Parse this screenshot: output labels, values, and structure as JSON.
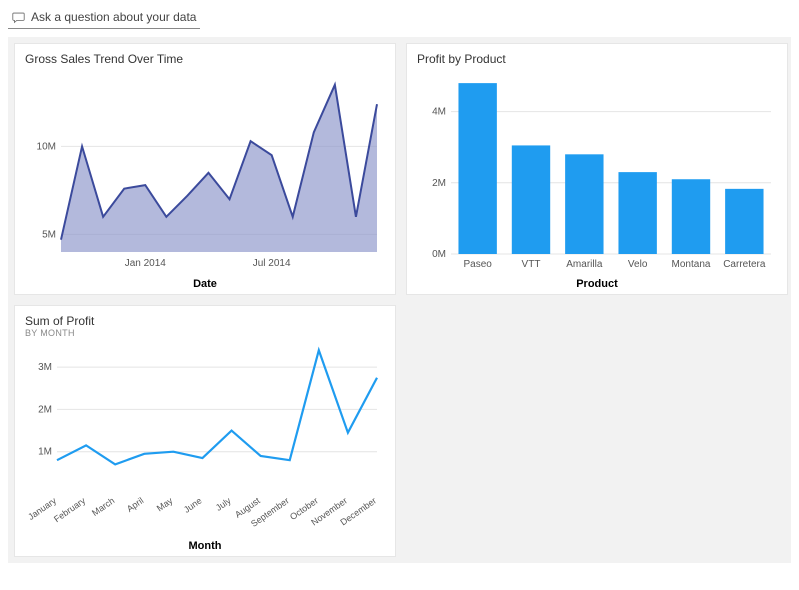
{
  "qna_placeholder": "Ask a question about your data",
  "cards": {
    "gross_sales": {
      "title": "Gross Sales Trend Over Time",
      "xlabel": "Date"
    },
    "profit_product": {
      "title": "Profit by Product",
      "xlabel": "Product"
    },
    "sum_profit": {
      "title": "Sum of Profit",
      "subtitle": "By Month",
      "xlabel": "Month"
    }
  },
  "chart_data": [
    {
      "id": "gross_sales",
      "type": "area",
      "title": "Gross Sales Trend Over Time",
      "xlabel": "Date",
      "ylabel": "",
      "ylim": [
        4000000,
        14000000
      ],
      "x_ticks_shown": [
        "Jan 2014",
        "Jul 2014"
      ],
      "y_ticks_shown": [
        "5M",
        "10M"
      ],
      "x": [
        "Sep 2013",
        "Oct 2013",
        "Nov 2013",
        "Dec 2013",
        "Jan 2014",
        "Feb 2014",
        "Mar 2014",
        "Apr 2014",
        "May 2014",
        "Jun 2014",
        "Jul 2014",
        "Aug 2014",
        "Sep 2014",
        "Oct 2014",
        "Nov 2014",
        "Dec 2014"
      ],
      "values": [
        4700000,
        10000000,
        6000000,
        7600000,
        7800000,
        6000000,
        7200000,
        8500000,
        7000000,
        10300000,
        9500000,
        6000000,
        10800000,
        13500000,
        6000000,
        12400000
      ]
    },
    {
      "id": "profit_product",
      "type": "bar",
      "title": "Profit by Product",
      "xlabel": "Product",
      "ylabel": "",
      "ylim": [
        0,
        5000000
      ],
      "y_ticks_shown": [
        "0M",
        "2M",
        "4M"
      ],
      "categories": [
        "Paseo",
        "VTT",
        "Amarilla",
        "Velo",
        "Montana",
        "Carretera"
      ],
      "values": [
        4800000,
        3050000,
        2800000,
        2300000,
        2100000,
        1830000
      ]
    },
    {
      "id": "sum_profit",
      "type": "line",
      "title": "Sum of Profit",
      "subtitle": "By Month",
      "xlabel": "Month",
      "ylabel": "",
      "ylim": [
        0,
        3500000
      ],
      "y_ticks_shown": [
        "1M",
        "2M",
        "3M"
      ],
      "categories": [
        "January",
        "February",
        "March",
        "April",
        "May",
        "June",
        "July",
        "August",
        "September",
        "October",
        "November",
        "December"
      ],
      "values": [
        800000,
        1150000,
        700000,
        950000,
        1000000,
        850000,
        1500000,
        900000,
        800000,
        3400000,
        1450000,
        2750000
      ]
    }
  ]
}
